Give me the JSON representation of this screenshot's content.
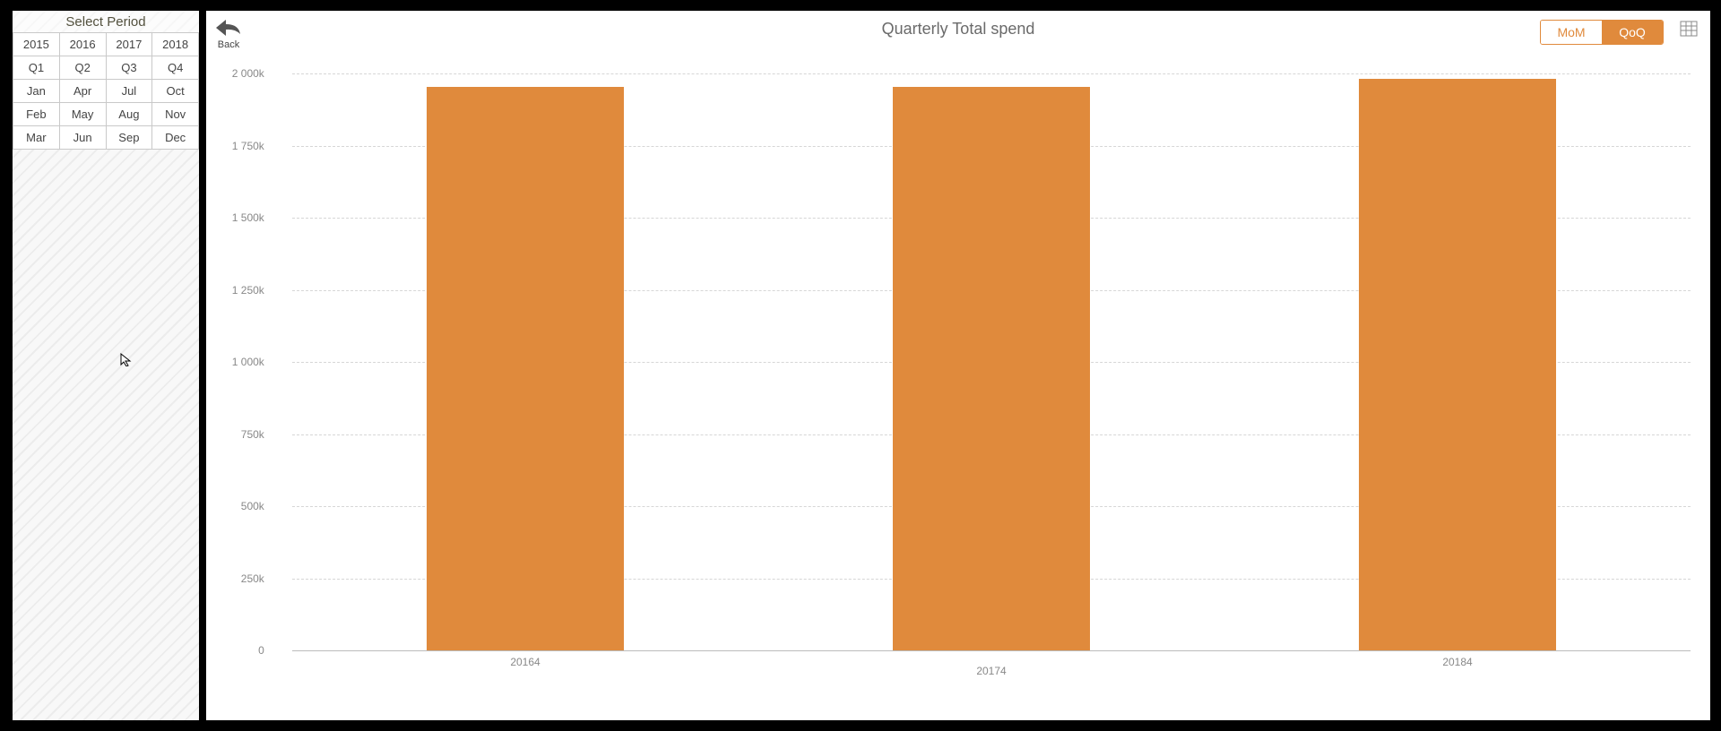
{
  "sidebar": {
    "title": "Select Period",
    "years": [
      "2015",
      "2016",
      "2017",
      "2018"
    ],
    "year_classes": [
      "y",
      "o",
      "o",
      "o"
    ],
    "quarters": [
      "Q1",
      "Q2",
      "Q3",
      "Q4"
    ],
    "quarter_classes": [
      "g",
      "g",
      "g",
      "o"
    ],
    "months": [
      [
        "Jan",
        "Apr",
        "Jul",
        "Oct"
      ],
      [
        "Feb",
        "May",
        "Aug",
        "Nov"
      ],
      [
        "Mar",
        "Jun",
        "Sep",
        "Dec"
      ]
    ],
    "months_active_col": 3
  },
  "header": {
    "back": "Back",
    "title": "Quarterly Total spend",
    "toggle": {
      "left": "MoM",
      "right": "QoQ",
      "active": "right"
    }
  },
  "chart_data": {
    "type": "bar",
    "title": "Quarterly Total spend",
    "categories": [
      "20164",
      "20174",
      "20184"
    ],
    "values": [
      1955000,
      1955000,
      1980000
    ],
    "ymin": 0,
    "ymax": 2000000,
    "yticks": [
      0,
      250000,
      500000,
      750000,
      1000000,
      1250000,
      1500000,
      1750000,
      2000000
    ],
    "ytick_labels": [
      "0",
      "250k",
      "500k",
      "750k",
      "1 000k",
      "1 250k",
      "1 500k",
      "1 750k",
      "2 000k"
    ],
    "bar_color": "#e08a3c"
  }
}
